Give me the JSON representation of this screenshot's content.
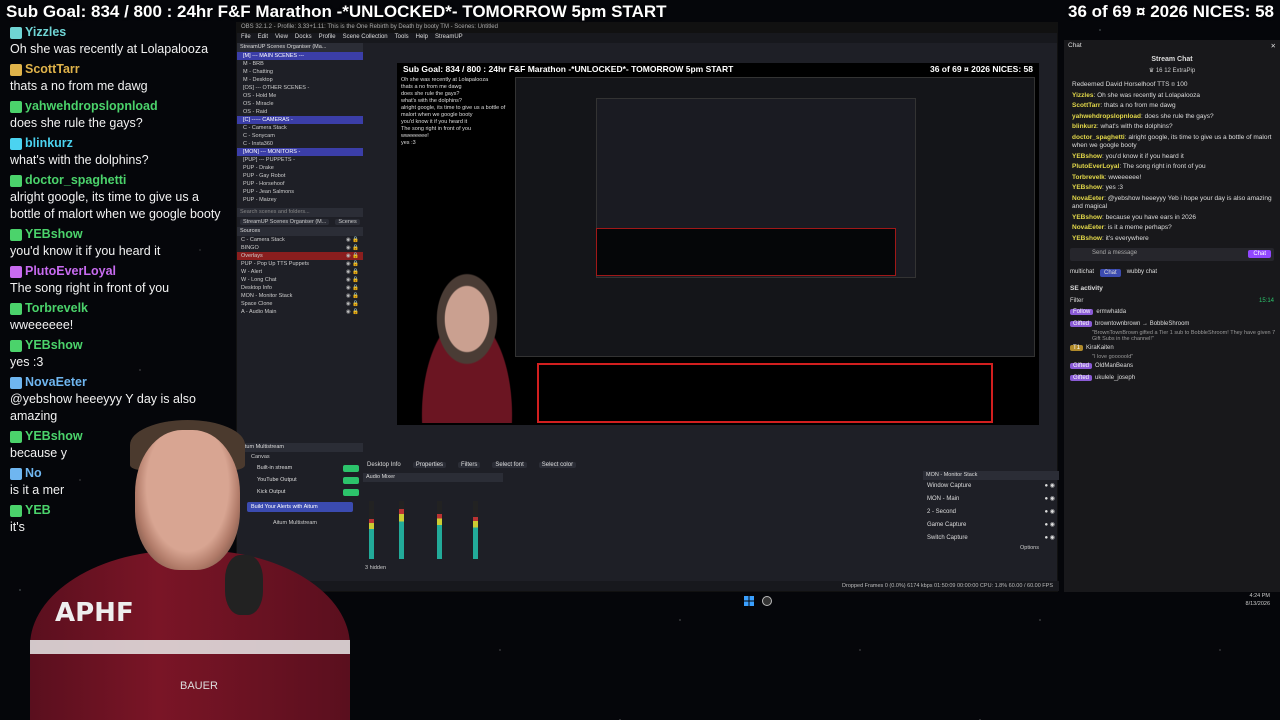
{
  "top_bar": {
    "left": "Sub Goal: 834 / 800 : 24hr F&F Marathon -*UNLOCKED*- TOMORROW 5pm START",
    "right": "36 of 69 ¤ 2026 NICES: 58"
  },
  "left_chat": [
    {
      "name": "Yizzles",
      "text": "Oh she was recently at Lolapalooza",
      "color": "#6fd4d4"
    },
    {
      "name": "ScottTarr",
      "text": "thats a no from me dawg",
      "color": "#e0b34a"
    },
    {
      "name": "yahwehdropslopnload",
      "text": "does she rule the gays?",
      "color": "#4bd36b"
    },
    {
      "name": "blinkurz",
      "text": "what's with the dolphins?",
      "color": "#4bd3f0"
    },
    {
      "name": "doctor_spaghetti",
      "text": "alright google, its time to give us a bottle of malort when we google booty",
      "color": "#4bd36b"
    },
    {
      "name": "YEBshow",
      "text": "you'd know it if you heard it",
      "color": "#4bd36b"
    },
    {
      "name": "PlutoEverLoyal",
      "text": "The song right in front of you",
      "color": "#c86bf0"
    },
    {
      "name": "Torbrevelk",
      "text": "wweeeeee!",
      "color": "#4bd36b"
    },
    {
      "name": "YEBshow",
      "text": "yes :3",
      "color": "#4bd36b"
    },
    {
      "name": "NovaEeter",
      "text": "@yebshow heeeyyy Y day is also amazing",
      "color": "#6fb6f0"
    },
    {
      "name": "YEBshow",
      "text": "because y",
      "color": "#4bd36b"
    },
    {
      "name": "No",
      "text": "is it a mer",
      "color": "#6fb6f0"
    },
    {
      "name": "YEB",
      "text": "it's",
      "color": "#4bd36b"
    }
  ],
  "obs": {
    "title": "OBS 32.1.2 - Profile: 3.33+1.11: This is the One Rebirth by Death by booty TM - Scenes: Untitled",
    "menu": [
      "File",
      "Edit",
      "View",
      "Docks",
      "Profile",
      "Scene Collection",
      "Tools",
      "Help",
      "StreamUP"
    ],
    "scenes_header": "StreamUP Scenes Organiser (Ma...",
    "scenes": [
      {
        "label": "[M] --- MAIN SCENES ---",
        "style": "sel"
      },
      {
        "label": "M - BRB",
        "style": ""
      },
      {
        "label": "M - Chatting",
        "style": ""
      },
      {
        "label": "M - Desktop",
        "style": ""
      },
      {
        "label": "[OS] --- OTHER SCENES -",
        "style": ""
      },
      {
        "label": "OS - Hold Me",
        "style": ""
      },
      {
        "label": "OS - Miracle",
        "style": ""
      },
      {
        "label": "OS - Raid",
        "style": ""
      },
      {
        "label": "[C] ----- CAMERAS -",
        "style": "sel"
      },
      {
        "label": "C - Camera Stack",
        "style": ""
      },
      {
        "label": "C - Sonycam",
        "style": ""
      },
      {
        "label": "C - Insta360",
        "style": ""
      },
      {
        "label": "[MON] --- MONITORS -",
        "style": "sel"
      },
      {
        "label": "[PUP] --- PUPPETS -",
        "style": ""
      },
      {
        "label": "PUP - Drake",
        "style": ""
      },
      {
        "label": "PUP - Gay Robot",
        "style": ""
      },
      {
        "label": "PUP - Horsehoof",
        "style": ""
      },
      {
        "label": "PUP - Jean Salmons",
        "style": ""
      },
      {
        "label": "PUP - Maizey",
        "style": ""
      }
    ],
    "search_placeholder": "Search scenes and folders...",
    "docks_tabs": [
      "StreamUP Scenes Organiser (M...",
      "Scenes"
    ],
    "sources_header": "Sources",
    "sources": [
      {
        "label": "C - Camera Stack",
        "sel": false
      },
      {
        "label": "BINGO",
        "sel": false
      },
      {
        "label": "Overlays",
        "sel": true
      },
      {
        "label": "PUP - Pop Up TTS Puppets",
        "sel": false
      },
      {
        "label": "W - Alert",
        "sel": false
      },
      {
        "label": "W - Long Chat",
        "sel": false
      },
      {
        "label": "Desktop Info",
        "sel": false
      },
      {
        "label": "MON - Monitor Stack",
        "sel": false
      },
      {
        "label": "Space Clone",
        "sel": false
      },
      {
        "label": "A - Audio Main",
        "sel": false
      }
    ],
    "multistream_header": "Aitum Multistream",
    "multistream_canvas": "Canvas",
    "outputs": [
      "Built-in stream",
      "YouTube Output",
      "Kick Output"
    ],
    "build_alerts": "Build Your Alerts with Aitum",
    "aitum_label": "Aitum Multistream",
    "preview_bar_left": "Sub Goal: 834 / 800 : 24hr F&F Marathon -*UNLOCKED*- TOMORROW 5pm START",
    "preview_bar_right": "36 of 69 ¤ 2026 NICES: 58",
    "toolbar_source": "Desktop Info",
    "toolbar_buttons": [
      "Properties",
      "Filters",
      "Select font",
      "Select color"
    ],
    "audio_mixer_label": "Audio Mixer",
    "hidden_label": "3 hidden",
    "monitor_stack_header": "MON - Monitor Stack",
    "monitor_items": [
      "Window Capture",
      "MON - Main",
      "2 - Second",
      "Game Capture",
      "Switch Capture"
    ],
    "options_label": "Options",
    "status_text": "Dropped Frames 0 (0.0%)   6174 kbps   01:50:09   00:00:00   CPU: 1.8% 60.00 / 60.00 FPS"
  },
  "preview_chat": [
    "Oh she was recently at Lolapalooza",
    "thats a no from me dawg",
    "does she rule the gays?",
    "what's with the dolphins?",
    "alright google, its time to give us a bottle of malort when we google booty",
    "you'd know it if you heard it",
    "The song right in front of you",
    "wweeeeee!",
    "yes :3"
  ],
  "right_panel": {
    "header": "Chat",
    "title": "Stream Chat",
    "counts": [
      "16",
      "12",
      "ExtraPip"
    ],
    "messages": [
      {
        "name": "",
        "text": "Redeemed David Horselhoof TTS ¤ 100"
      },
      {
        "name": "Yizzles",
        "text": "Oh she was recently at Lolapalooza"
      },
      {
        "name": "ScottTarr",
        "text": "thats a no from me dawg"
      },
      {
        "name": "yahwehdropslopnload",
        "text": "does she rule the gays?"
      },
      {
        "name": "blinkurz",
        "text": "what's with the dolphins?"
      },
      {
        "name": "doctor_spaghetti",
        "text": "alright google, its time to give us a bottle of malort when we google booty"
      },
      {
        "name": "YEBshow",
        "text": "you'd know it if you heard it"
      },
      {
        "name": "PlutoEverLoyal",
        "text": "The song right in front of you"
      },
      {
        "name": "Torbrevelk",
        "text": "wweeeeee!"
      },
      {
        "name": "YEBshow",
        "text": "yes :3"
      },
      {
        "name": "NovaEeter",
        "text": "@yebshow heeeyyy Yeb i hope your day is also amazing and magical"
      },
      {
        "name": "YEBshow",
        "text": "because you have ears in 2026"
      },
      {
        "name": "NovaEeter",
        "text": "is it a meme perhaps?"
      },
      {
        "name": "YEBshow",
        "text": "it's everywhere"
      }
    ],
    "input_placeholder": "Send a message",
    "chat_button": "Chat",
    "bottom_tabs": [
      "multichat",
      "Chat",
      "wubby chat"
    ],
    "se_header": "SE activity",
    "filter": "Filter",
    "se_time": "15:14",
    "se_items": [
      {
        "tag": "Follow",
        "name": "ermwhatda",
        "gold": false,
        "quote": ""
      },
      {
        "tag": "Gifted",
        "name": "browntownbrown → BobbleShroom",
        "gold": false,
        "quote": "\"BrownTownBrown gifted a Tier 1 sub to BobbleShroom! They have given 7 Gift Subs in the channel!\""
      },
      {
        "tag": "T1",
        "name": "KiraKaiten",
        "gold": true,
        "quote": "\"I love gooooold\""
      },
      {
        "tag": "Gifted",
        "name": "OldManBeans",
        "gold": false,
        "quote": ""
      },
      {
        "tag": "Gifted",
        "name": "ukulele_joseph",
        "gold": false,
        "quote": ""
      }
    ]
  },
  "clock": {
    "time": "4:24 PM",
    "date": "8/13/2026"
  },
  "webcam": {
    "logo": "APHF",
    "brand": "BAUER"
  }
}
